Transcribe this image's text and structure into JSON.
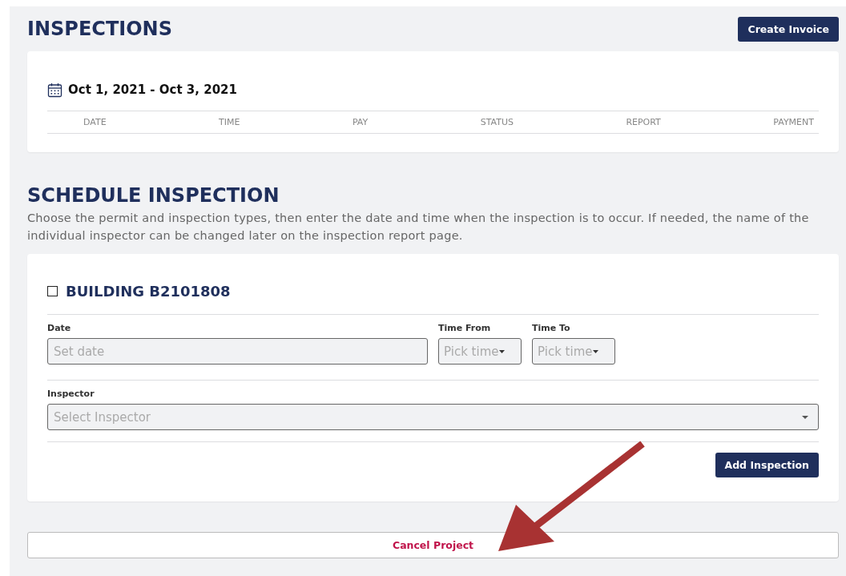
{
  "header": {
    "title": "INSPECTIONS",
    "button": "Create Invoice"
  },
  "inspections": {
    "date_range": "Oct 1, 2021 - Oct 3, 2021",
    "columns": [
      "DATE",
      "TIME",
      "PAY",
      "STATUS",
      "REPORT",
      "PAYMENT"
    ]
  },
  "schedule": {
    "title": "SCHEDULE INSPECTION",
    "description": "Choose the permit and inspection types, then enter the date and time when the inspection is to occur. If needed, the name of the individual inspector can be changed later on the inspection report page.",
    "permit": {
      "label": "BUILDING B2101808",
      "checked": false
    },
    "date": {
      "label": "Date",
      "placeholder": "Set date"
    },
    "time_from": {
      "label": "Time From",
      "placeholder": "Pick time"
    },
    "time_to": {
      "label": "Time To",
      "placeholder": "Pick time"
    },
    "inspector": {
      "label": "Inspector",
      "placeholder": "Select Inspector"
    },
    "button": "Add Inspection"
  },
  "cancel_button": "Cancel Project"
}
